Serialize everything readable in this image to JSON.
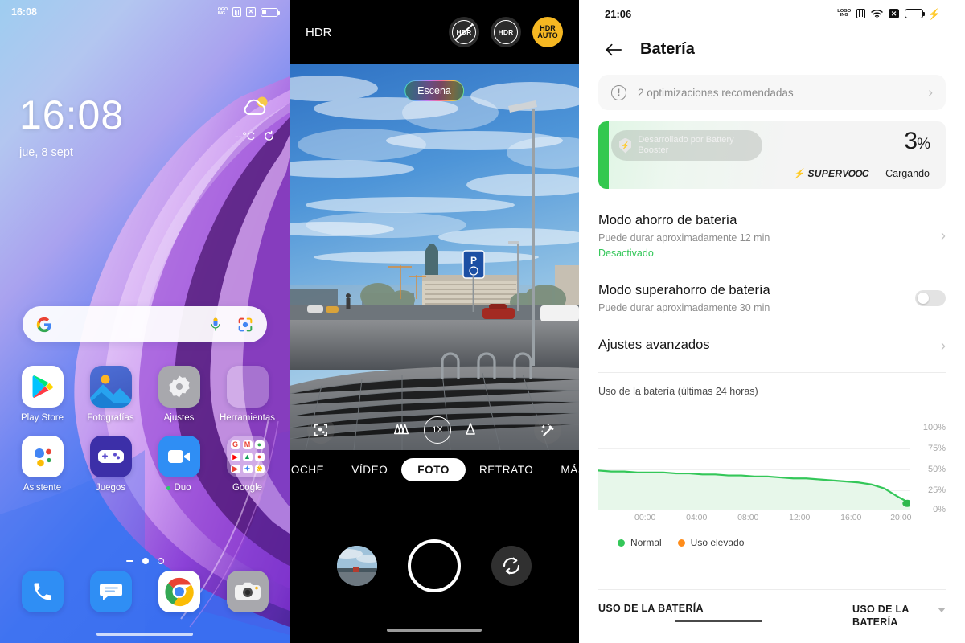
{
  "home": {
    "status": {
      "time": "16:08",
      "logo_text": "LOGO\nING",
      "icons": [
        "nfc-icon",
        "x-icon",
        "battery-icon"
      ]
    },
    "lock": {
      "time": "16:08",
      "date": "jue, 8 sept"
    },
    "weather": {
      "temp": "--°C",
      "icon": "cloud-sun-icon",
      "refresh": "refresh-icon"
    },
    "search": {
      "placeholder": "",
      "google_icon": "google-g-icon",
      "mic": "microphone-icon",
      "lens": "google-lens-icon"
    },
    "apps": [
      {
        "label": "Play Store",
        "icon": "play-store-icon"
      },
      {
        "label": "Fotografías",
        "icon": "photos-icon"
      },
      {
        "label": "Ajustes",
        "icon": "settings-gear-icon"
      },
      {
        "label": "Herramientas",
        "icon": "tools-folder-icon"
      },
      {
        "label": "Asistente",
        "icon": "google-assistant-icon"
      },
      {
        "label": "Juegos",
        "icon": "games-controller-icon"
      },
      {
        "label": "Duo",
        "icon": "google-duo-icon",
        "badge_dot": true
      },
      {
        "label": "Google",
        "icon": "google-folder-icon"
      }
    ],
    "pager": {
      "pages": 3,
      "active": 1
    },
    "dock": [
      {
        "label": "Teléfono",
        "icon": "phone-icon"
      },
      {
        "label": "Mensajes",
        "icon": "messages-icon"
      },
      {
        "label": "Chrome",
        "icon": "chrome-icon"
      },
      {
        "label": "Cámara",
        "icon": "camera-icon"
      }
    ]
  },
  "camera": {
    "top_label": "HDR",
    "hdr_options": [
      {
        "name": "hdr-off",
        "label": "HDR",
        "state": "off"
      },
      {
        "name": "hdr-on",
        "label": "HDR",
        "state": "on"
      },
      {
        "name": "hdr-auto",
        "line1": "HDR",
        "line2": "AUTO",
        "state": "selected"
      }
    ],
    "scene_chip": "Escena",
    "controls": {
      "ai_scene": "ai-scene-icon",
      "ultra_wide": "ultra-wide-icon",
      "zoom_level": "1X",
      "tele": "tele-icon",
      "filters": "magic-wand-icon"
    },
    "modes": [
      {
        "label": "NOCHE",
        "selected": false
      },
      {
        "label": "VÍDEO",
        "selected": false
      },
      {
        "label": "FOTO",
        "selected": true
      },
      {
        "label": "RETRATO",
        "selected": false
      },
      {
        "label": "MÁS",
        "selected": false
      }
    ],
    "shutter": {
      "gallery": "gallery-thumbnail",
      "capture": "shutter-button",
      "flip": "flip-camera-icon"
    }
  },
  "battery": {
    "status": {
      "time": "21:06",
      "logo_text": "LOGO\nING",
      "icons": [
        "nfc-icon",
        "wifi-icon",
        "x-icon",
        "battery-icon",
        "charging-bolt-icon"
      ]
    },
    "header": {
      "back": "back-arrow-icon",
      "title": "Batería"
    },
    "optimization_card": {
      "icon": "warning-circle-icon",
      "text": "2 optimizaciones recomendadas",
      "chevron": "chevron-right-icon"
    },
    "battery_card": {
      "booster_badge": "Desarrollado por Battery Booster",
      "shield_icon": "shield-icon",
      "percent": "3",
      "percent_symbol": "%",
      "charge_tech": "SUPERVOOC",
      "charge_tech_prefix": "SUPER",
      "charge_tech_suffix": "VOOC",
      "separator": "|",
      "status": "Cargando",
      "accent": "#33c84f"
    },
    "settings": [
      {
        "title": "Modo ahorro de batería",
        "subtitle": "Puede durar aproximadamente 12 min",
        "state": "Desactivado",
        "control": "chevron"
      },
      {
        "title": "Modo superahorro de batería",
        "subtitle": "Puede durar aproximadamente 30 min",
        "state": "",
        "control": "toggle-off"
      },
      {
        "title": "Ajustes avanzados",
        "subtitle": "",
        "state": "",
        "control": "chevron"
      }
    ],
    "legend": [
      {
        "label": "Normal",
        "color": "#34c759"
      },
      {
        "label": "Uso elevado",
        "color": "#ff8c1a"
      }
    ],
    "footer": {
      "left_tab": "USO DE LA BATERÍA",
      "right_tab": "USO DE LA BATERÍA",
      "caret": "chevron-down-icon"
    }
  },
  "chart_data": {
    "type": "area",
    "title": "Uso de la batería (últimas 24 horas)",
    "xlabel": "",
    "ylabel": "",
    "ylim": [
      0,
      100
    ],
    "yticks": [
      0,
      25,
      50,
      75,
      100
    ],
    "ytick_labels": [
      "0%",
      "25%",
      "50%",
      "75%",
      "100%"
    ],
    "xticks": [
      "00:00",
      "04:00",
      "08:00",
      "12:00",
      "16:00",
      "20:00"
    ],
    "grid": true,
    "legend_position": "bottom-left",
    "line_color": "#34c759",
    "fill_color": "#e7f7ea",
    "x": [
      0,
      1,
      2,
      3,
      4,
      5,
      6,
      7,
      8,
      9,
      10,
      11,
      12,
      13,
      14,
      15,
      16,
      17,
      18,
      19,
      20,
      21,
      22,
      23,
      24
    ],
    "values": [
      36,
      35,
      35,
      34,
      34,
      34,
      33,
      33,
      32,
      32,
      31,
      31,
      30,
      30,
      29,
      28,
      28,
      27,
      26,
      25,
      24,
      22,
      18,
      10,
      3
    ],
    "end_marker": {
      "x": 24,
      "y": 3,
      "color": "#2eb84c"
    }
  }
}
